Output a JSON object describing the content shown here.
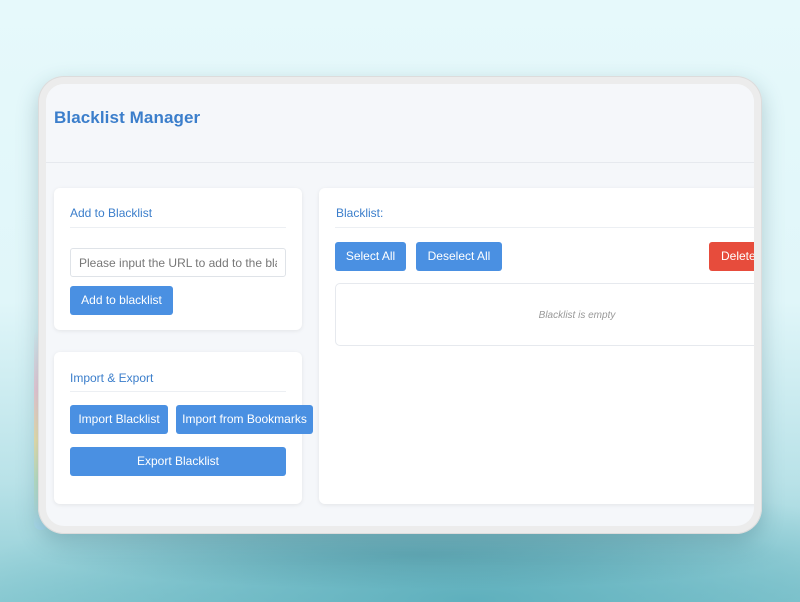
{
  "header": {
    "title": "Blacklist Manager"
  },
  "add_card": {
    "title": "Add to Blacklist",
    "url_input_placeholder": "Please input the URL to add to the blacklist",
    "url_input_value": "",
    "add_button_label": "Add to blacklist"
  },
  "import_export_card": {
    "title": "Import & Export",
    "import_button_label": "Import Blacklist",
    "import_bookmarks_button_label": "Import from Bookmarks",
    "export_button_label": "Export Blacklist"
  },
  "blacklist_card": {
    "title": "Blacklist:",
    "select_all_label": "Select All",
    "deselect_all_label": "Deselect All",
    "delete_label": "Delete",
    "empty_message": "Blacklist is empty"
  },
  "colors": {
    "accent": "#4a90e2",
    "title": "#3b7ecb",
    "danger": "#e74c3c",
    "panel_bg": "#f5f7fa"
  }
}
